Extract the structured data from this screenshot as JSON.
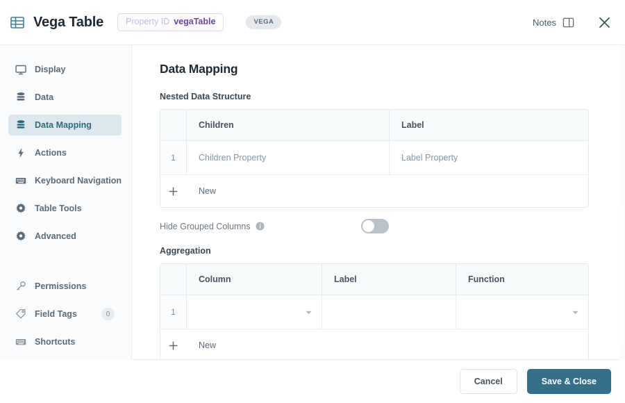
{
  "header": {
    "icon": "table-grid-icon",
    "title": "Vega Table",
    "property_chip": {
      "key": "Property ID",
      "value": "vegaTable"
    },
    "badge": "VEGA",
    "notes_label": "Notes",
    "notes_icon": "panel-right-icon",
    "close_icon": "close-icon"
  },
  "sidebar": {
    "items": [
      {
        "label": "Display",
        "icon": "monitor-icon",
        "active": false
      },
      {
        "label": "Data",
        "icon": "database-icon",
        "active": false
      },
      {
        "label": "Data Mapping",
        "icon": "database-icon",
        "active": true
      },
      {
        "label": "Actions",
        "icon": "lightning-bolt-icon",
        "active": false
      },
      {
        "label": "Keyboard Navigation",
        "icon": "keyboard-icon",
        "active": false
      },
      {
        "label": "Table Tools",
        "icon": "gear-icon",
        "active": false
      },
      {
        "label": "Advanced",
        "icon": "gear-icon",
        "active": false
      }
    ],
    "items_secondary": [
      {
        "label": "Permissions",
        "icon": "key-icon",
        "badge": null
      },
      {
        "label": "Field Tags",
        "icon": "tag-icon",
        "badge": "0"
      },
      {
        "label": "Shortcuts",
        "icon": "keyboard-icon",
        "badge": null
      }
    ]
  },
  "main": {
    "page_title": "Data Mapping",
    "nested": {
      "section_label": "Nested Data Structure",
      "columns": [
        "Children",
        "Label"
      ],
      "rows": [
        {
          "index": "1",
          "children_placeholder": "Children Property",
          "label_placeholder": "Label Property"
        }
      ],
      "new_row_label": "New",
      "add_icon": "plus-icon"
    },
    "hide_grouped": {
      "label": "Hide Grouped Columns",
      "info_icon": "info-icon",
      "enabled": false
    },
    "aggregation": {
      "section_label": "Aggregation",
      "columns": [
        "Column",
        "Label",
        "Function"
      ],
      "rows": [
        {
          "index": "1",
          "column_value": "",
          "label_value": "",
          "function_value": ""
        }
      ],
      "new_row_label": "New",
      "add_icon": "plus-icon",
      "caret_icon": "chevron-down-icon"
    }
  },
  "footer": {
    "cancel_label": "Cancel",
    "save_label": "Save & Close"
  },
  "colors": {
    "accent": "#35708a",
    "active_nav_bg": "#dde8ee",
    "active_nav_text": "#2d6a80",
    "chip_border": "#e4d7f2",
    "chip_key": "#c9b6e0",
    "chip_value": "#6b42a8",
    "badge_bg": "#e5e9ee"
  }
}
